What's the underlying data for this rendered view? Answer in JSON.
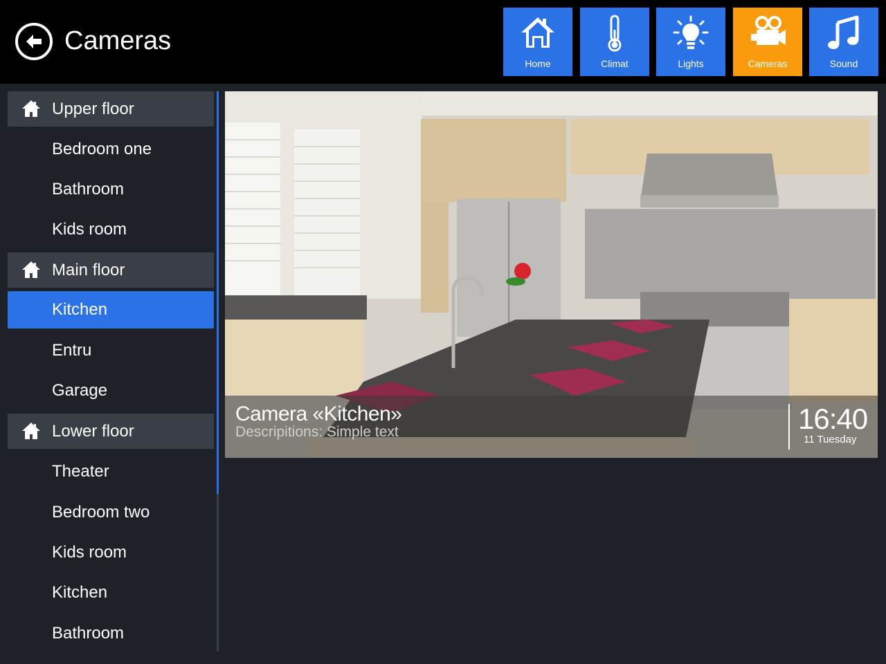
{
  "header": {
    "title": "Cameras",
    "back_icon": "back-arrow-icon"
  },
  "nav": [
    {
      "label": "Home",
      "icon": "home-icon",
      "active": false
    },
    {
      "label": "Climat",
      "icon": "thermometer-icon",
      "active": false
    },
    {
      "label": "Lights",
      "icon": "lightbulb-icon",
      "active": false
    },
    {
      "label": "Cameras",
      "icon": "video-camera-icon",
      "active": true
    },
    {
      "label": "Sound",
      "icon": "music-note-icon",
      "active": false
    }
  ],
  "colors": {
    "accent": "#2a72e6",
    "active_tile": "#f99b0c",
    "background": "#1e2128",
    "section": "#3a3e47"
  },
  "sidebar": {
    "sections": [
      {
        "label": "Upper floor",
        "rooms": [
          "Bedroom one",
          "Bathroom",
          "Kids room"
        ]
      },
      {
        "label": "Main floor",
        "rooms": [
          "Kitchen",
          "Entru",
          "Garage"
        ]
      },
      {
        "label": "Lower floor",
        "rooms": [
          "Theater",
          "Bedroom two",
          "Kids room",
          "Kitchen",
          "Bathroom"
        ]
      }
    ],
    "selected": "Kitchen"
  },
  "camera": {
    "title": "Camera «Kitchen»",
    "description": "Descripitions: Simple text",
    "time": "16:40",
    "date": "11 Tuesday"
  }
}
